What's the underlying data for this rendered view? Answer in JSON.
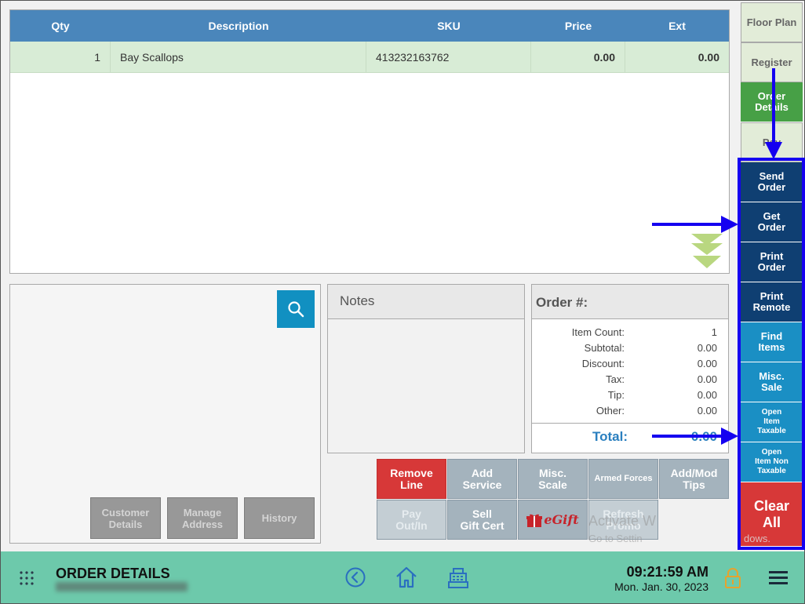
{
  "grid": {
    "headers": {
      "qty": "Qty",
      "description": "Description",
      "sku": "SKU",
      "price": "Price",
      "ext": "Ext"
    },
    "rows": [
      {
        "qty": "1",
        "description": "Bay Scallops",
        "sku": "413232163762",
        "price": "0.00",
        "ext": "0.00"
      }
    ]
  },
  "customer": {
    "buttons": {
      "customer_details": "Customer\nDetails",
      "manage_address": "Manage\nAddress",
      "history": "History"
    }
  },
  "notes": {
    "title": "Notes",
    "value": ""
  },
  "summary": {
    "order_label": "Order #:",
    "rows": [
      {
        "label": "Item Count:",
        "value": "1"
      },
      {
        "label": "Subtotal:",
        "value": "0.00"
      },
      {
        "label": "Discount:",
        "value": "0.00"
      },
      {
        "label": "Tax:",
        "value": "0.00"
      },
      {
        "label": "Tip:",
        "value": "0.00"
      },
      {
        "label": "Other:",
        "value": "0.00"
      }
    ],
    "total_label": "Total:",
    "total_value": "0.00"
  },
  "actions": {
    "remove_line": "Remove\nLine",
    "add_service": "Add\nService",
    "misc_scale": "Misc.\nScale",
    "armed_forces": "Armed Forces",
    "add_mod_tips": "Add/Mod\nTips",
    "pay_out_in": "Pay\nOut/In",
    "sell_gift_cert": "Sell\nGift Cert",
    "egift": "eGift",
    "refresh_promo": "Refresh\nPromo"
  },
  "sidebar": {
    "floor_plan": "Floor Plan",
    "register": "Register",
    "order_details": "Order\nDetails",
    "pay": "Pay",
    "send_order": "Send\nOrder",
    "get_order": "Get\nOrder",
    "print_order": "Print\nOrder",
    "print_remote": "Print\nRemote",
    "find_items": "Find\nItems",
    "misc_sale": "Misc.\nSale",
    "open_item_taxable": "Open\nItem\nTaxable",
    "open_item_non_taxable": "Open\nItem Non\nTaxable",
    "clear_all": "Clear\nAll"
  },
  "bottom_bar": {
    "title": "ORDER DETAILS",
    "time": "09:21:59 AM",
    "date": "Mon. Jan. 30, 2023"
  },
  "watermark": {
    "line1": "Activate W",
    "line2": "Go to Settin",
    "line3": "dows."
  },
  "colors": {
    "header_blue": "#4a86bb",
    "row_green": "#d8ecd6",
    "navy": "#0f3f72",
    "sky": "#1a8fc4",
    "danger": "#d73838",
    "bar_teal": "#6dc9ab",
    "annotation_blue": "#1500f0"
  },
  "icons": [
    "search-icon",
    "apps-grid-icon",
    "back-arrow-icon",
    "home-icon",
    "cash-register-icon",
    "lock-icon",
    "menu-icon",
    "scroll-down-icon",
    "gift-icon"
  ]
}
